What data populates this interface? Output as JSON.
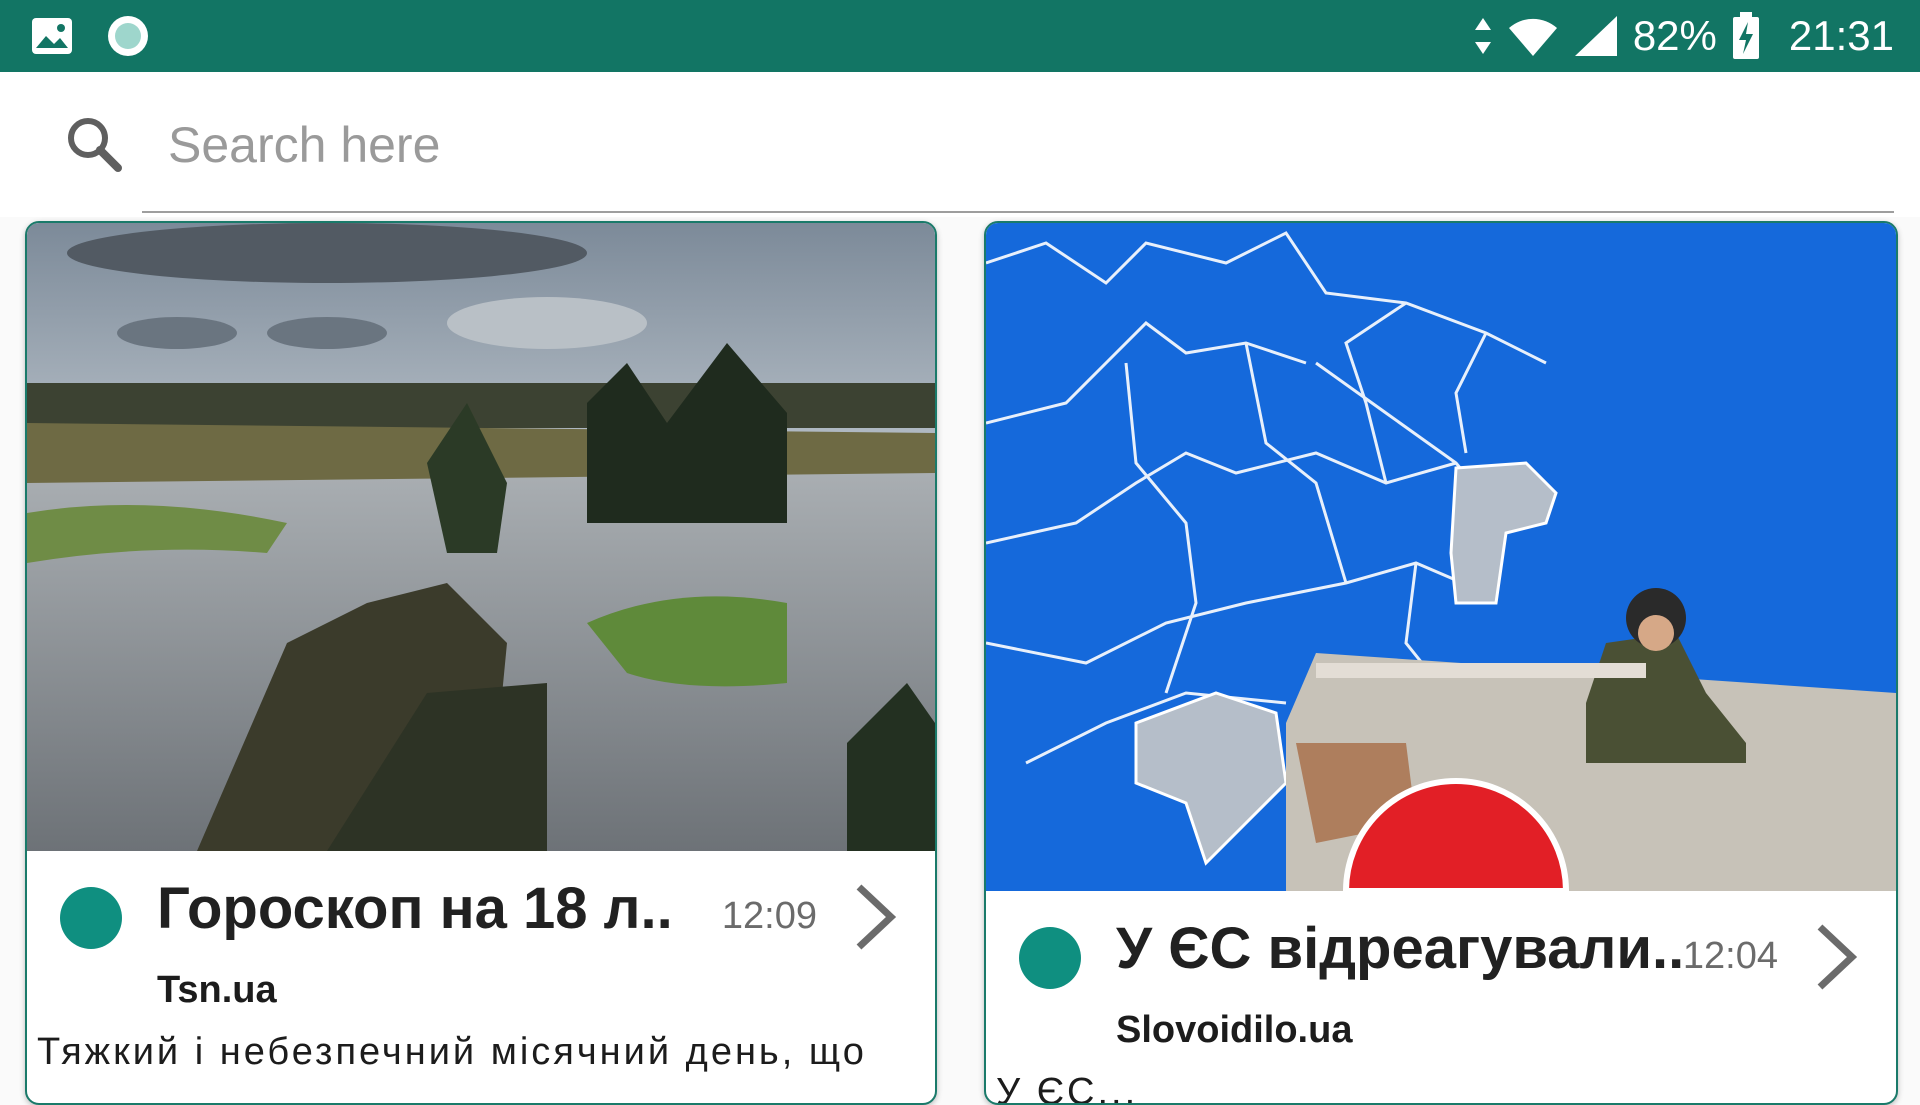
{
  "status_bar": {
    "battery": "82%",
    "time": "21:31",
    "icons": [
      "gallery-icon",
      "circle-app-icon",
      "data-arrows-icon",
      "wifi-icon",
      "cell-signal-icon",
      "battery-charging-icon"
    ]
  },
  "search": {
    "placeholder": "Search here",
    "icon": "search-icon"
  },
  "colors": {
    "accent": "#127564",
    "dot": "#0f8f80"
  },
  "articles": [
    {
      "title": "Гороскоп на 18 л..",
      "time": "12:09",
      "source": "Tsn.ua",
      "description": "Тяжкий і небезпечний місячний день, що"
    },
    {
      "title": "У ЄС відреагували..",
      "time": "12:04",
      "source": "Slovoidilo.ua",
      "description": "У ЄС..."
    }
  ]
}
